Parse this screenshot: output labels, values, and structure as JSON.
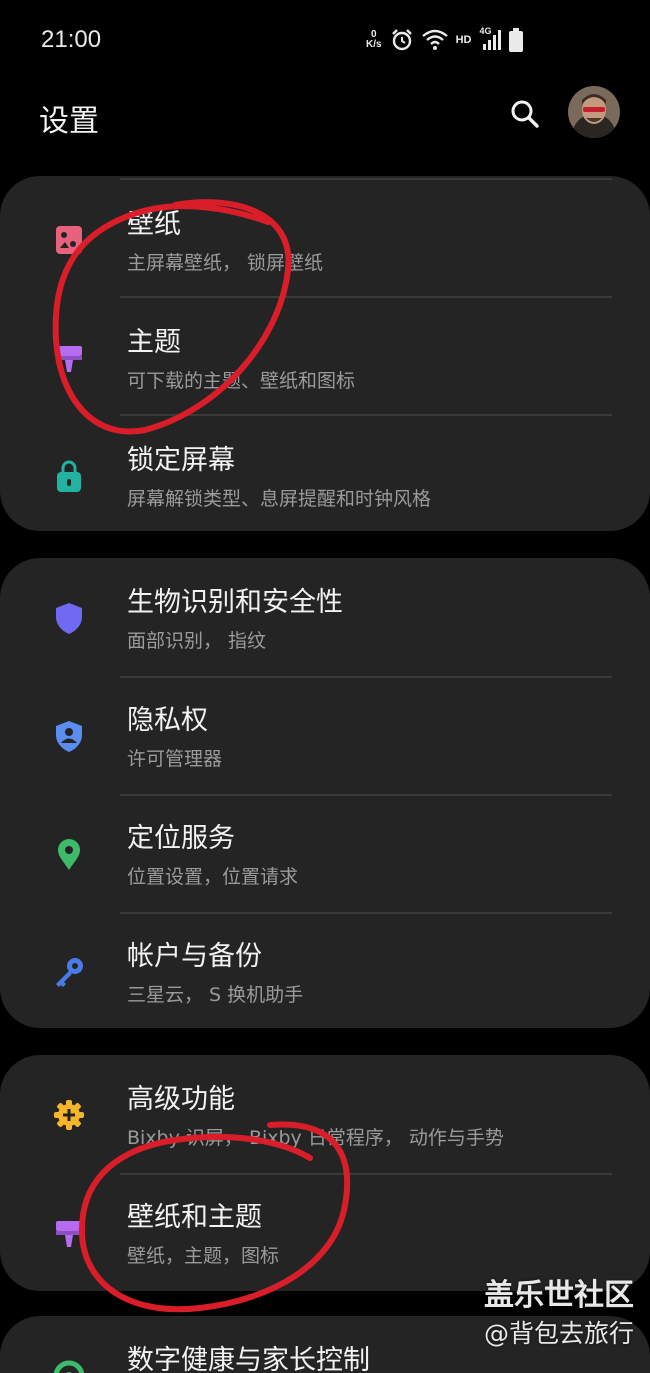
{
  "status_bar": {
    "time": "21:00",
    "net_speed_value": "0",
    "net_speed_unit": "K/s",
    "hd_label": "HD",
    "network_label": "4G",
    "icons": [
      "alarm-icon",
      "wifi-icon",
      "signal-icon",
      "battery-icon"
    ]
  },
  "header": {
    "title": "设置",
    "search_icon": "search-icon",
    "avatar_icon": "avatar"
  },
  "groups": [
    {
      "items": [
        {
          "title": "壁纸",
          "subtitle": "主屏幕壁纸， 锁屏壁纸",
          "icon": "wallpaper-icon",
          "color": "#e8617d"
        },
        {
          "title": "主题",
          "subtitle": "可下载的主题、壁纸和图标",
          "icon": "theme-brush-icon",
          "color": "#b66cf0"
        },
        {
          "title": "锁定屏幕",
          "subtitle": "屏幕解锁类型、息屏提醒和时钟风格",
          "icon": "lock-icon",
          "color": "#21b3a0"
        }
      ]
    },
    {
      "items": [
        {
          "title": "生物识别和安全性",
          "subtitle": "面部识别， 指纹",
          "icon": "shield-icon",
          "color": "#7069f2"
        },
        {
          "title": "隐私权",
          "subtitle": "许可管理器",
          "icon": "privacy-shield-icon",
          "color": "#5b8cf0"
        },
        {
          "title": "定位服务",
          "subtitle": "位置设置，位置请求",
          "icon": "location-pin-icon",
          "color": "#3dbb6a"
        },
        {
          "title": "帐户与备份",
          "subtitle": "三星云， S 换机助手",
          "icon": "key-icon",
          "color": "#4a7ce8"
        }
      ]
    },
    {
      "items": [
        {
          "title": "高级功能",
          "subtitle": "Bixby 识屏， Bixby 日常程序， 动作与手势",
          "icon": "gear-plus-icon",
          "color": "#f5b62a"
        },
        {
          "title": "壁纸和主题",
          "subtitle": "壁纸，主题，图标",
          "icon": "theme-brush-icon",
          "color": "#b66cf0"
        }
      ]
    },
    {
      "items": [
        {
          "title": "数字健康与家长控制",
          "subtitle": "",
          "icon": "digital-wellbeing-icon",
          "color": "#3dbb6a"
        }
      ]
    }
  ],
  "watermark": {
    "line1": "盖乐世社区",
    "line2": "@背包去旅行"
  },
  "colors": {
    "background": "#000000",
    "card": "#242424",
    "annotation_red": "#d91e2a"
  }
}
